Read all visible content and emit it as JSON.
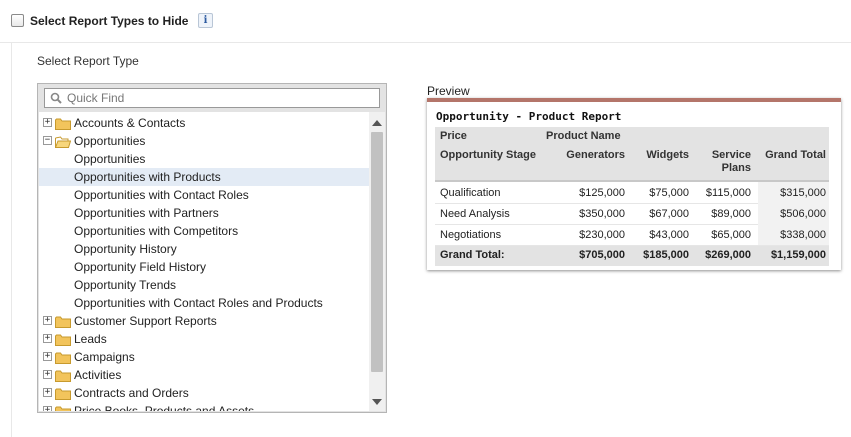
{
  "header": {
    "checkbox_label": "Select Report Types to Hide",
    "info_glyph": "i"
  },
  "section": {
    "label": "Select Report Type"
  },
  "search": {
    "placeholder": "Quick Find"
  },
  "tree": {
    "items": [
      {
        "label": "Accounts & Contacts",
        "type": "folder",
        "expanded": false
      },
      {
        "label": "Opportunities",
        "type": "folder",
        "expanded": true
      },
      {
        "label": "Opportunities",
        "type": "child"
      },
      {
        "label": "Opportunities with Products",
        "type": "child",
        "selected": true
      },
      {
        "label": "Opportunities with Contact Roles",
        "type": "child"
      },
      {
        "label": "Opportunities with Partners",
        "type": "child"
      },
      {
        "label": "Opportunities with Competitors",
        "type": "child"
      },
      {
        "label": "Opportunity History",
        "type": "child"
      },
      {
        "label": "Opportunity Field History",
        "type": "child"
      },
      {
        "label": "Opportunity Trends",
        "type": "child"
      },
      {
        "label": "Opportunities with Contact Roles and Products",
        "type": "child"
      },
      {
        "label": "Customer Support Reports",
        "type": "folder",
        "expanded": false
      },
      {
        "label": "Leads",
        "type": "folder",
        "expanded": false
      },
      {
        "label": "Campaigns",
        "type": "folder",
        "expanded": false
      },
      {
        "label": "Activities",
        "type": "folder",
        "expanded": false
      },
      {
        "label": "Contracts and Orders",
        "type": "folder",
        "expanded": false
      },
      {
        "label": "Price Books, Products and Assets",
        "type": "folder",
        "expanded": false
      }
    ]
  },
  "preview": {
    "label": "Preview",
    "title": "Opportunity - Product Report",
    "header_row1": {
      "col1": "Price",
      "col2": "Product Name"
    },
    "header_row2": {
      "stage": "Opportunity Stage",
      "c1": "Generators",
      "c2": "Widgets",
      "c3a": "Service",
      "c3b": "Plans",
      "total": "Grand Total"
    },
    "rows": [
      {
        "stage": "Qualification",
        "v1": "$125,000",
        "v2": "$75,000",
        "v3": "$115,000",
        "total": "$315,000"
      },
      {
        "stage": "Need Analysis",
        "v1": "$350,000",
        "v2": "$67,000",
        "v3": "$89,000",
        "total": "$506,000"
      },
      {
        "stage": "Negotiations",
        "v1": "$230,000",
        "v2": "$43,000",
        "v3": "$65,000",
        "total": "$338,000"
      }
    ],
    "grand": {
      "label": "Grand Total:",
      "v1": "$705,000",
      "v2": "$185,000",
      "v3": "$269,000",
      "total": "$1,159,000"
    }
  },
  "colors": {
    "preview_accent": "#b4756a",
    "selected_row": "#e3ebf5",
    "folder": "#f2c45c"
  }
}
